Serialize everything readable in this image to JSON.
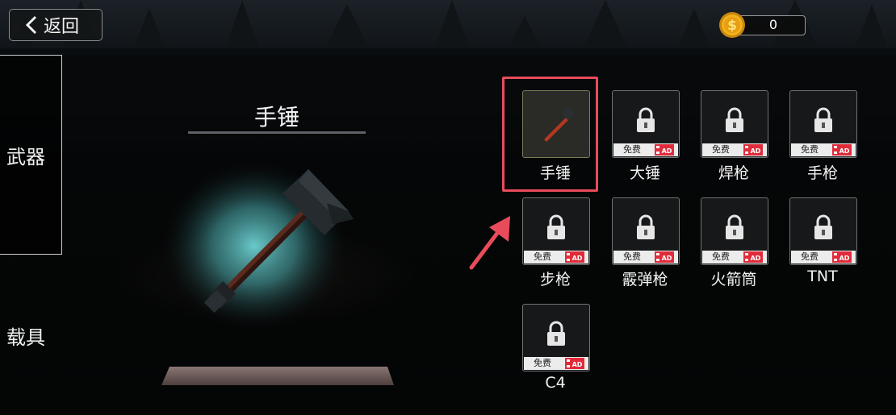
{
  "header": {
    "back_label": "返回",
    "coins": "0"
  },
  "sidebar": {
    "tabs": [
      {
        "label": "武器",
        "active": true
      },
      {
        "label": "载具",
        "active": false
      }
    ]
  },
  "preview": {
    "title": "手锤"
  },
  "items": [
    {
      "name": "手锤",
      "locked": false,
      "selected": true
    },
    {
      "name": "大锤",
      "locked": true,
      "free_label": "免费"
    },
    {
      "name": "焊枪",
      "locked": true,
      "free_label": "免费"
    },
    {
      "name": "手枪",
      "locked": true,
      "free_label": "免费"
    },
    {
      "name": "步枪",
      "locked": true,
      "free_label": "免费"
    },
    {
      "name": "霰弹枪",
      "locked": true,
      "free_label": "免费"
    },
    {
      "name": "火箭筒",
      "locked": true,
      "free_label": "免费"
    },
    {
      "name": "TNT",
      "locked": true,
      "free_label": "免费"
    },
    {
      "name": "C4",
      "locked": true,
      "free_label": "免费"
    }
  ],
  "colors": {
    "highlight": "#e84c5a",
    "ad_badge": "#e02b3a",
    "coin": "#f0b21d"
  }
}
